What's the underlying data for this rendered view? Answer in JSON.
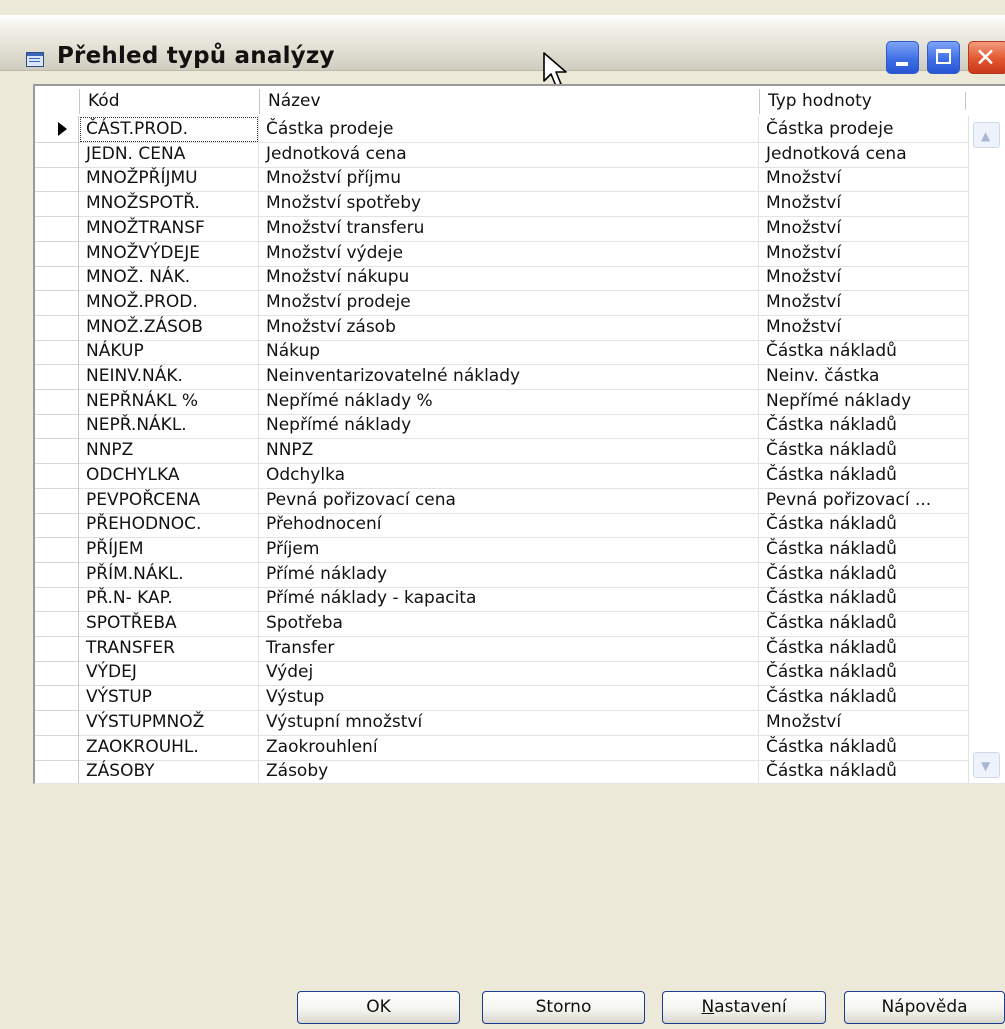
{
  "window": {
    "title": "Přehled typů analýzy"
  },
  "columns": {
    "code": "Kód",
    "name": "Název",
    "value_type": "Typ hodnoty"
  },
  "rows": [
    {
      "code": "ČÁST.PROD.",
      "name": "Částka prodeje",
      "value_type": "Částka prodeje"
    },
    {
      "code": "JEDN. CENA",
      "name": "Jednotková cena",
      "value_type": "Jednotková cena"
    },
    {
      "code": "MNOŽPŘÍJMU",
      "name": "Množství příjmu",
      "value_type": "Množství"
    },
    {
      "code": "MNOŽSPOTŘ.",
      "name": "Množství spotřeby",
      "value_type": "Množství"
    },
    {
      "code": "MNOŽTRANSF",
      "name": "Množství transferu",
      "value_type": "Množství"
    },
    {
      "code": "MNOŽVÝDEJE",
      "name": "Množství výdeje",
      "value_type": "Množství"
    },
    {
      "code": "MNOŽ. NÁK.",
      "name": "Množství nákupu",
      "value_type": "Množství"
    },
    {
      "code": "MNOŽ.PROD.",
      "name": "Množství prodeje",
      "value_type": "Množství"
    },
    {
      "code": "MNOŽ.ZÁSOB",
      "name": "Množství zásob",
      "value_type": "Množství"
    },
    {
      "code": "NÁKUP",
      "name": "Nákup",
      "value_type": "Částka nákladů"
    },
    {
      "code": "NEINV.NÁK.",
      "name": "Neinventarizovatelné náklady",
      "value_type": "Neinv. částka"
    },
    {
      "code": "NEPŘNÁKL %",
      "name": "Nepřímé náklady %",
      "value_type": "Nepřímé náklady"
    },
    {
      "code": "NEPŘ.NÁKL.",
      "name": "Nepřímé náklady",
      "value_type": "Částka nákladů"
    },
    {
      "code": "NNPZ",
      "name": "NNPZ",
      "value_type": "Částka nákladů"
    },
    {
      "code": "ODCHYLKA",
      "name": "Odchylka",
      "value_type": "Částka nákladů"
    },
    {
      "code": "PEVPOŘCENA",
      "name": "Pevná pořizovací cena",
      "value_type": "Pevná pořizovací ..."
    },
    {
      "code": "PŘEHODNOC.",
      "name": "Přehodnocení",
      "value_type": "Částka nákladů"
    },
    {
      "code": "PŘÍJEM",
      "name": "Příjem",
      "value_type": "Částka nákladů"
    },
    {
      "code": "PŘÍM.NÁKL.",
      "name": "Přímé náklady",
      "value_type": "Částka nákladů"
    },
    {
      "code": "PŘ.N- KAP.",
      "name": "Přímé náklady - kapacita",
      "value_type": "Částka nákladů"
    },
    {
      "code": "SPOTŘEBA",
      "name": "Spotřeba",
      "value_type": "Částka nákladů"
    },
    {
      "code": "TRANSFER",
      "name": "Transfer",
      "value_type": "Částka nákladů"
    },
    {
      "code": "VÝDEJ",
      "name": "Výdej",
      "value_type": "Částka nákladů"
    },
    {
      "code": "VÝSTUP",
      "name": "Výstup",
      "value_type": "Částka nákladů"
    },
    {
      "code": "VÝSTUPMNOŽ",
      "name": "Výstupní množství",
      "value_type": "Množství"
    },
    {
      "code": "ZAOKROUHL.",
      "name": "Zaokrouhlení",
      "value_type": "Částka nákladů"
    },
    {
      "code": "ZÁSOBY",
      "name": "Zásoby",
      "value_type": "Částka nákladů"
    }
  ],
  "selected_row": 0,
  "buttons": {
    "ok": "OK",
    "cancel": "Storno",
    "setup_mnemonic": "N",
    "setup_rest": "astavení",
    "help": "Nápověda"
  },
  "caption_icons": [
    "minimize-icon",
    "maximize-icon",
    "close-icon"
  ],
  "colors": {
    "title_gradient_light": "#ffffff",
    "window_bg": "#ece9d8",
    "caption_blue": "#3f6fe6",
    "close_red": "#e2572f"
  }
}
